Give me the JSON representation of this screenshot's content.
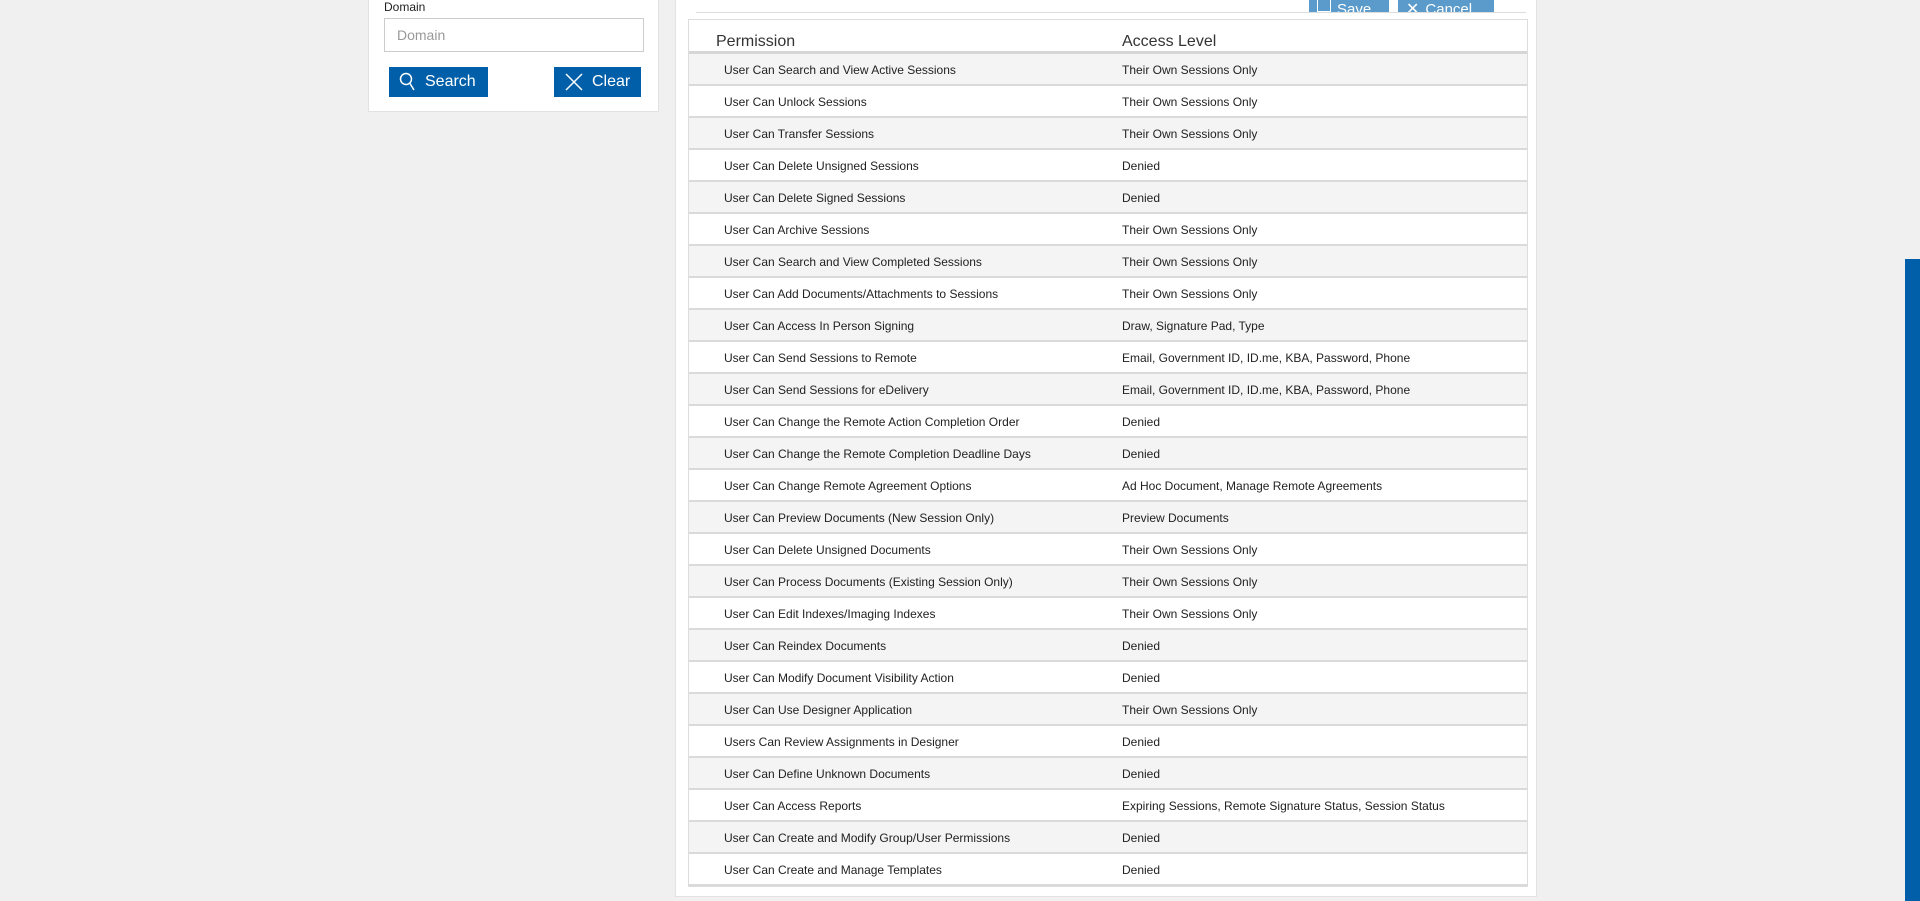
{
  "filter": {
    "domain_label": "Domain",
    "domain_placeholder": "Domain",
    "domain_value": "",
    "search_label": "Search",
    "clear_label": "Clear"
  },
  "toolbar": {
    "save_label": "Save",
    "cancel_label": "Cancel"
  },
  "table": {
    "headers": [
      "Permission",
      "Access Level"
    ],
    "rows": [
      [
        "User Can Search and View Active Sessions",
        "Their Own Sessions Only"
      ],
      [
        "User Can Unlock Sessions",
        "Their Own Sessions Only"
      ],
      [
        "User Can Transfer Sessions",
        "Their Own Sessions Only"
      ],
      [
        "User Can Delete Unsigned Sessions",
        "Denied"
      ],
      [
        "User Can Delete Signed Sessions",
        "Denied"
      ],
      [
        "User Can Archive Sessions",
        "Their Own Sessions Only"
      ],
      [
        "User Can Search and View Completed Sessions",
        "Their Own Sessions Only"
      ],
      [
        "User Can Add Documents/Attachments to Sessions",
        "Their Own Sessions Only"
      ],
      [
        "User Can Access In Person Signing",
        "Draw, Signature Pad, Type"
      ],
      [
        "User Can Send Sessions to Remote",
        "Email, Government ID, ID.me, KBA, Password, Phone"
      ],
      [
        "User Can Send Sessions for eDelivery",
        "Email, Government ID, ID.me, KBA, Password, Phone"
      ],
      [
        "User Can Change the Remote Action Completion Order",
        "Denied"
      ],
      [
        "User Can Change the Remote Completion Deadline Days",
        "Denied"
      ],
      [
        "User Can Change Remote Agreement Options",
        "Ad Hoc Document, Manage Remote Agreements"
      ],
      [
        "User Can Preview Documents (New Session Only)",
        "Preview Documents"
      ],
      [
        "User Can Delete Unsigned Documents",
        "Their Own Sessions Only"
      ],
      [
        "User Can Process Documents (Existing Session Only)",
        "Their Own Sessions Only"
      ],
      [
        "User Can Edit Indexes/Imaging Indexes",
        "Their Own Sessions Only"
      ],
      [
        "User Can Reindex Documents",
        "Denied"
      ],
      [
        "User Can Modify Document Visibility Action",
        "Denied"
      ],
      [
        "User Can Use Designer Application",
        "Their Own Sessions Only"
      ],
      [
        "Users Can Review Assignments in Designer",
        "Denied"
      ],
      [
        "User Can Define Unknown Documents",
        "Denied"
      ],
      [
        "User Can Access Reports",
        "Expiring Sessions, Remote Signature Status, Session Status"
      ],
      [
        "User Can Create and Modify Group/User Permissions",
        "Denied"
      ],
      [
        "User Can Create and Manage Templates",
        "Denied"
      ]
    ]
  },
  "colors": {
    "accent": "#005fa8",
    "toolbar_button": "#5b9bcb"
  }
}
